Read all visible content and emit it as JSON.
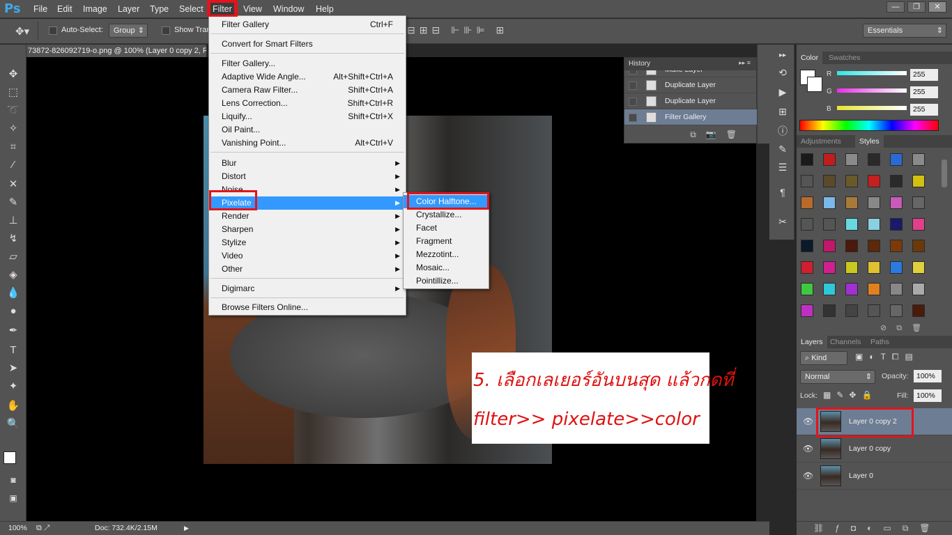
{
  "app": {
    "logo": "Ps"
  },
  "menubar": {
    "items": [
      "File",
      "Edit",
      "Image",
      "Layer",
      "Type",
      "Select",
      "Filter",
      "View",
      "Window",
      "Help"
    ]
  },
  "window_controls": {
    "minimize": "—",
    "restore": "❐",
    "close": "✕"
  },
  "options_bar": {
    "auto_select_label": "Auto-Select:",
    "auto_select_value": "Group",
    "show_transform_label": "Show Tran",
    "workspace": "Essentials"
  },
  "document": {
    "tab_title": "73872-826092719-o.png @ 100% (Layer 0 copy 2, R"
  },
  "filter_menu": {
    "items": [
      {
        "label": "Filter Gallery",
        "shortcut": "Ctrl+F"
      },
      {
        "label": "Convert for Smart Filters",
        "shortcut": ""
      },
      {
        "label": "Filter Gallery...",
        "shortcut": ""
      },
      {
        "label": "Adaptive Wide Angle...",
        "shortcut": "Alt+Shift+Ctrl+A"
      },
      {
        "label": "Camera Raw Filter...",
        "shortcut": "Shift+Ctrl+A"
      },
      {
        "label": "Lens Correction...",
        "shortcut": "Shift+Ctrl+R"
      },
      {
        "label": "Liquify...",
        "shortcut": "Shift+Ctrl+X"
      },
      {
        "label": "Oil Paint...",
        "shortcut": ""
      },
      {
        "label": "Vanishing Point...",
        "shortcut": "Alt+Ctrl+V"
      },
      {
        "label": "Blur",
        "shortcut": ""
      },
      {
        "label": "Distort",
        "shortcut": ""
      },
      {
        "label": "Noise",
        "shortcut": ""
      },
      {
        "label": "Pixelate",
        "shortcut": ""
      },
      {
        "label": "Render",
        "shortcut": ""
      },
      {
        "label": "Sharpen",
        "shortcut": ""
      },
      {
        "label": "Stylize",
        "shortcut": ""
      },
      {
        "label": "Video",
        "shortcut": ""
      },
      {
        "label": "Other",
        "shortcut": ""
      },
      {
        "label": "Digimarc",
        "shortcut": ""
      },
      {
        "label": "Browse Filters Online...",
        "shortcut": ""
      }
    ]
  },
  "pixelate_submenu": {
    "items": [
      "Color Halftone...",
      "Crystallize...",
      "Facet",
      "Fragment",
      "Mezzotint...",
      "Mosaic...",
      "Pointillize..."
    ]
  },
  "history": {
    "title": "History",
    "rows": [
      "Make Layer",
      "Duplicate Layer",
      "Duplicate Layer",
      "Filter Gallery"
    ]
  },
  "color_panel": {
    "tabs": [
      "Color",
      "Swatches"
    ],
    "channels": [
      {
        "label": "R",
        "value": "255"
      },
      {
        "label": "G",
        "value": "255"
      },
      {
        "label": "B",
        "value": "255"
      }
    ],
    "colors": {
      "r": "#2ee6e6",
      "g": "#e62ee6",
      "b": "#e6e62e"
    }
  },
  "styles_panel": {
    "tabs": [
      "Adjustments",
      "Styles"
    ]
  },
  "layers_panel": {
    "tabs": [
      "Layers",
      "Channels",
      "Paths"
    ],
    "kind_label": "Kind",
    "blend_mode": "Normal",
    "opacity_label": "Opacity:",
    "opacity_value": "100%",
    "lock_label": "Lock:",
    "fill_label": "Fill:",
    "fill_value": "100%",
    "layers": [
      "Layer 0 copy 2",
      "Layer 0 copy",
      "Layer 0"
    ]
  },
  "annotation": {
    "line1": "5. เลือกเลเยอร์อันบนสุด แล้วกดที่",
    "line2": "filter>> pixelate>>color"
  },
  "status": {
    "zoom": "100%",
    "doc": "Doc: 732.4K/2.15M"
  },
  "accent": {
    "red_highlight": "#e3141b",
    "menu_selection": "#3399ff"
  }
}
